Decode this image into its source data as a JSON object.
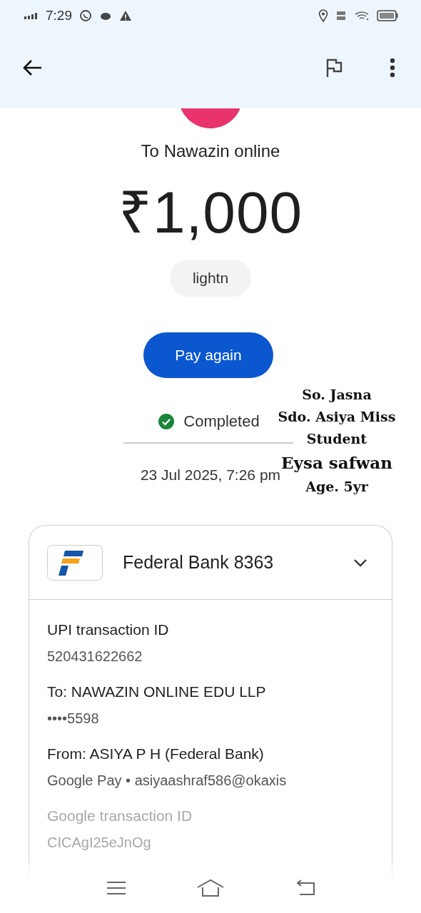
{
  "status_bar": {
    "time": "7:29"
  },
  "recipient": "To Nawazin online",
  "amount": "₹1,000",
  "note": "lightn",
  "pay_button": "Pay again",
  "status": {
    "label": "Completed",
    "completed": true
  },
  "datetime": "23 Jul 2025, 7:26 pm",
  "account": {
    "bank": "Federal Bank 8363",
    "expanded": false
  },
  "details": [
    {
      "label": "UPI transaction ID",
      "value": "520431622662"
    },
    {
      "label": "To: NAWAZIN ONLINE EDU LLP",
      "value": "••••5598"
    },
    {
      "label": "From: ASIYA P H (Federal Bank)",
      "value": "Google Pay • asiyaashraf586@okaxis"
    },
    {
      "label": "Google transaction ID",
      "value": "CICAgI25eJnOg"
    }
  ],
  "annotation": [
    "So. Jasna",
    "Sdo. Asiya Miss",
    "Student",
    "Eysa safwan",
    "Age. 5yr"
  ]
}
